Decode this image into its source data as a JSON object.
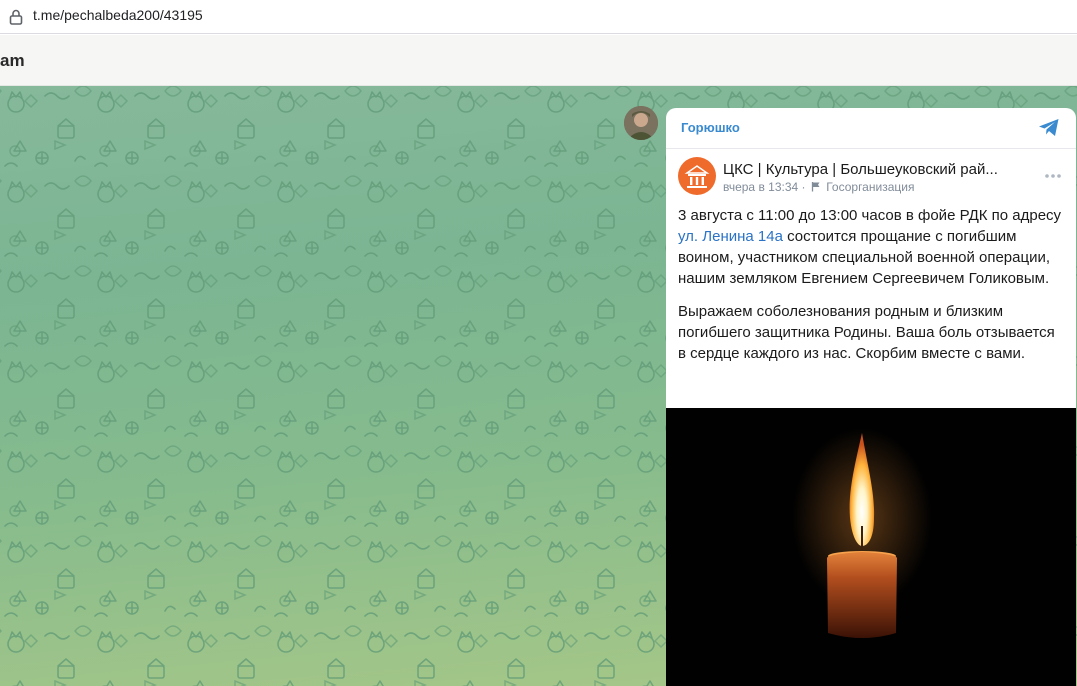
{
  "browser": {
    "url": "t.me/pechalbeda200/43195"
  },
  "app": {
    "title_fragment": "am"
  },
  "message": {
    "sender": "Горюшко"
  },
  "card": {
    "name": "ЦКС | Культура | Большеуковский рай...",
    "time": "вчера в 13:34",
    "meta_separator": "·",
    "org_type": "Госорганизация",
    "paragraph1_before_link": "3 августа с 11:00 до 13:00 часов в фойе РДК по адресу ",
    "link_text": "ул. Ленина 14а",
    "paragraph1_after_link": " состоится прощание с погибшим воином, участником специальной военной операции, нашим земляком Евгением Сергеевичем Голиковым.",
    "paragraph2": "Выражаем соболезнования родным и близким погибшего защитника Родины. Ваша боль отзывается в сердце каждого из нас. Скорбим вместе с вами."
  },
  "colors": {
    "sender": "#3a8ad0",
    "link": "#2a73c5",
    "logo": "#ef6b2c",
    "meta": "#818c99"
  },
  "icons": [
    "lock-icon",
    "telegram-icon",
    "flag-icon",
    "more-icon",
    "candle-image"
  ]
}
